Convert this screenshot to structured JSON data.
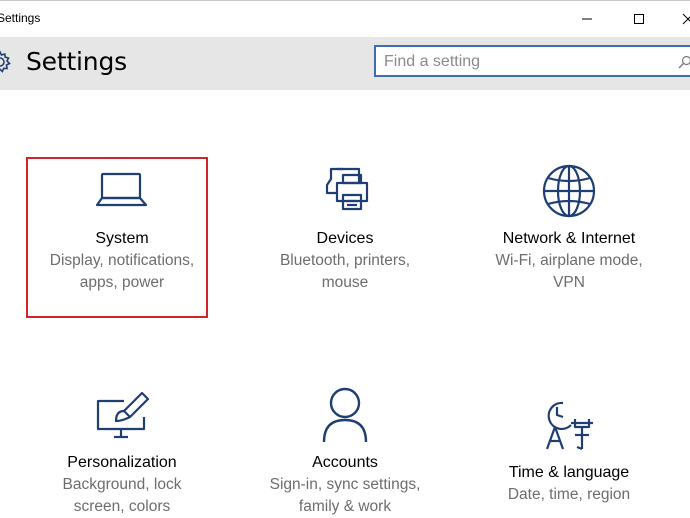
{
  "window": {
    "title": "Settings",
    "controls": [
      "minimize",
      "maximize",
      "close"
    ]
  },
  "header": {
    "title": "Settings",
    "icon": "gear-icon",
    "search": {
      "placeholder": "Find a setting",
      "value": ""
    }
  },
  "tiles": [
    {
      "name": "System",
      "desc": "Display, notifications,\napps, power",
      "icon": "laptop-icon",
      "highlighted": true
    },
    {
      "name": "Devices",
      "desc": "Bluetooth, printers,\nmouse",
      "icon": "printer-icon"
    },
    {
      "name": "Network & Internet",
      "desc": "Wi-Fi, airplane mode,\nVPN",
      "icon": "globe-icon"
    },
    {
      "name": "Personalization",
      "desc": "Background, lock\nscreen, colors",
      "icon": "paintbrush-icon"
    },
    {
      "name": "Accounts",
      "desc": "Sign-in, sync settings,\nfamily & work",
      "icon": "person-icon"
    },
    {
      "name": "Time & language",
      "desc": "Date, time, region",
      "icon": "clock-language-icon"
    }
  ],
  "colors": {
    "icon_stroke": "#1f3f73",
    "header_bg": "#e6e6e6",
    "search_border": "#3c6fb2",
    "highlight": "#d2232a"
  }
}
